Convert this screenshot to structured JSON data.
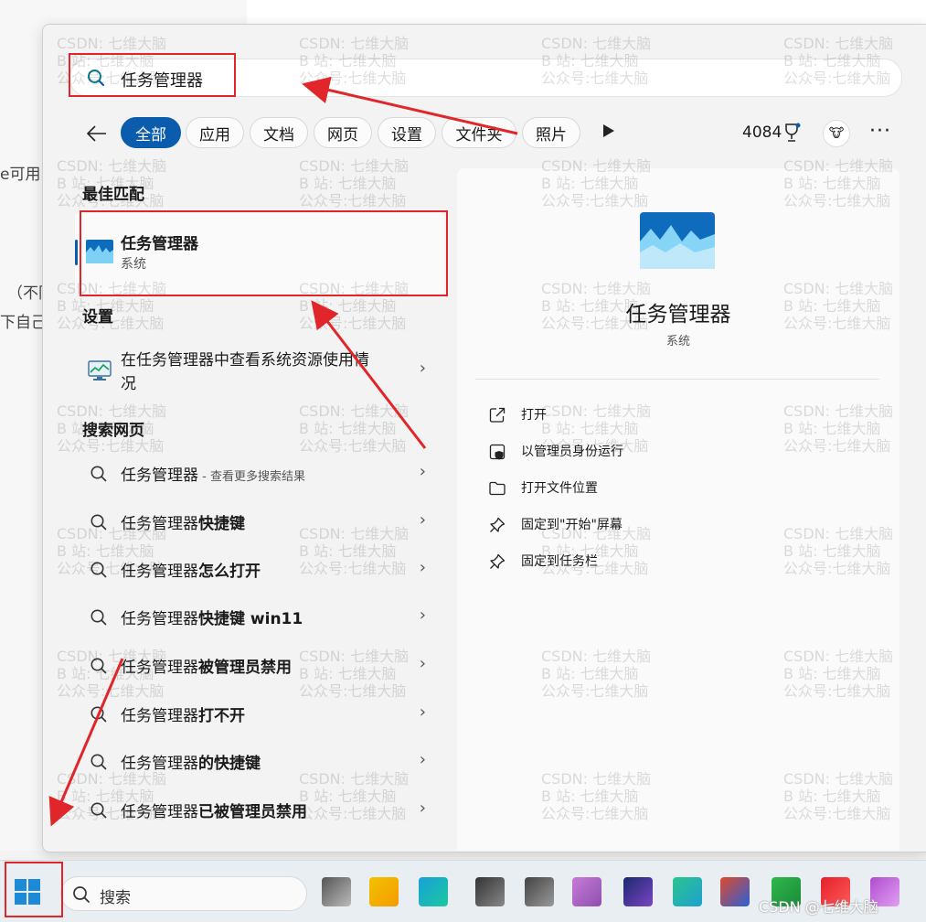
{
  "background": {
    "fragment_1": "e可用",
    "fragment_2": "（不同",
    "fragment_3": "下自己"
  },
  "search": {
    "query": "任务管理器"
  },
  "filters": {
    "all": "全部",
    "apps": "应用",
    "documents": "文档",
    "web": "网页",
    "settings": "设置",
    "folders": "文件夹",
    "photos": "照片"
  },
  "points": "4084",
  "sections": {
    "best_match": "最佳匹配",
    "settings": "设置",
    "search_web": "搜索网页"
  },
  "best_match": {
    "title": "任务管理器",
    "subtitle": "系统"
  },
  "settings_item": {
    "label": "在任务管理器中查看系统资源使用情况"
  },
  "web_results": [
    {
      "prefix": "任务管理器",
      "bold": "",
      "hint": " - 查看更多搜索结果"
    },
    {
      "prefix": "任务管理器",
      "bold": "快捷键",
      "hint": ""
    },
    {
      "prefix": "任务管理器",
      "bold": "怎么打开",
      "hint": ""
    },
    {
      "prefix": "任务管理器",
      "bold": "快捷键 win11",
      "hint": ""
    },
    {
      "prefix": "任务管理器",
      "bold": "被管理员禁用",
      "hint": ""
    },
    {
      "prefix": "任务管理器",
      "bold": "打不开",
      "hint": ""
    },
    {
      "prefix": "任务管理器",
      "bold": "的快捷键",
      "hint": ""
    },
    {
      "prefix": "任务管理器",
      "bold": "已被管理员禁用",
      "hint": ""
    }
  ],
  "preview": {
    "title": "任务管理器",
    "subtitle": "系统",
    "actions": [
      "打开",
      "以管理员身份运行",
      "打开文件位置",
      "固定到\"开始\"屏幕",
      "固定到任务栏"
    ]
  },
  "watermark": "CSDN: 七维大脑\nB 站: 七维大脑\n公众号:七维大脑",
  "taskbar": {
    "search_placeholder": "搜索"
  },
  "credit": "CSDN @七维大脑",
  "colors": {
    "accent": "#0b5cad",
    "annotation": "#e0262a"
  }
}
